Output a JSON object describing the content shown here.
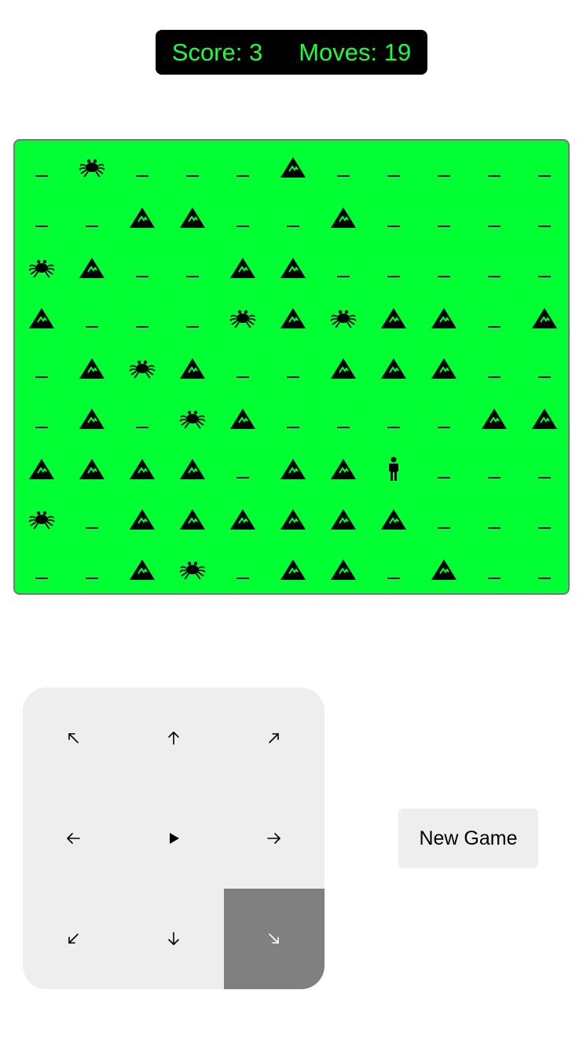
{
  "score": {
    "label": "Score: 3"
  },
  "moves": {
    "label": "Moves: 19"
  },
  "colors": {
    "board": "#00ff33",
    "score_text": "#1aff3c",
    "active_button": "#808080"
  },
  "legend": {
    "_": "empty",
    "M": "mountain",
    "S": "spider",
    "P": "player"
  },
  "board": {
    "rows": [
      "_S___M_____",
      "__MM__M____",
      "SM__MM_____",
      "M___SMSMM_M",
      "_MSM__MMM__",
      "_M_SM____MM",
      "MMMM_MMP___",
      "S_MMMMMM___",
      "__MS_MM_M__"
    ]
  },
  "dpad": {
    "buttons": [
      {
        "name": "nw",
        "icon": "arrow-up-left-icon"
      },
      {
        "name": "n",
        "icon": "arrow-up-icon"
      },
      {
        "name": "ne",
        "icon": "arrow-up-right-icon"
      },
      {
        "name": "w",
        "icon": "arrow-left-icon"
      },
      {
        "name": "wait",
        "icon": "play-icon"
      },
      {
        "name": "e",
        "icon": "arrow-right-icon"
      },
      {
        "name": "sw",
        "icon": "arrow-down-left-icon"
      },
      {
        "name": "s",
        "icon": "arrow-down-icon"
      },
      {
        "name": "se",
        "icon": "arrow-down-right-icon",
        "active": true
      }
    ]
  },
  "new_game": {
    "label": "New Game"
  }
}
